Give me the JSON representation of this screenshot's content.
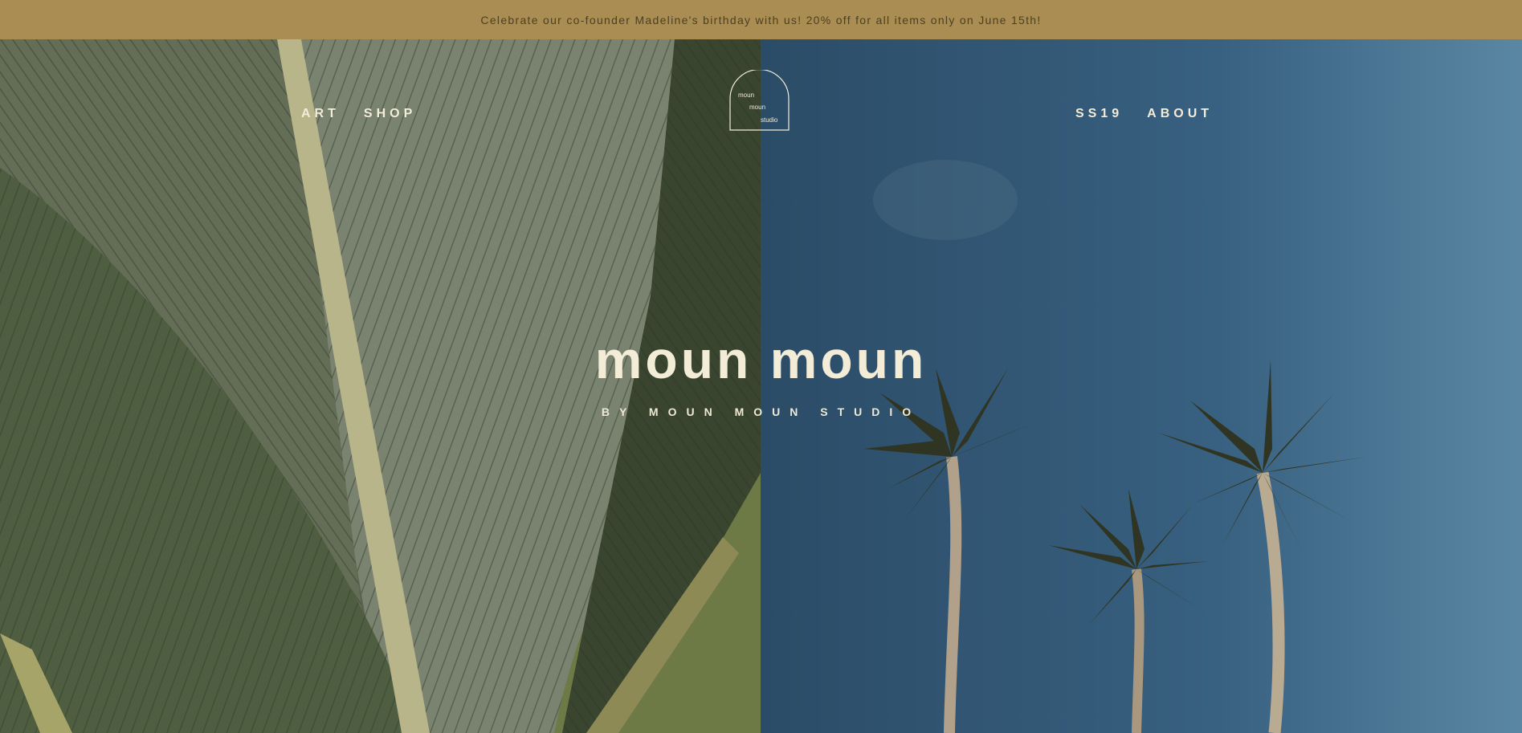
{
  "promo": {
    "text": "Celebrate our co-founder Madeline's birthday with us! 20% off for all items only on June 15th!"
  },
  "nav": {
    "left": [
      {
        "label": "ART"
      },
      {
        "label": "SHOP"
      }
    ],
    "right": [
      {
        "label": "SS19"
      },
      {
        "label": "ABOUT"
      }
    ]
  },
  "logo": {
    "lines": [
      "moun",
      "moun",
      "studio"
    ]
  },
  "hero": {
    "title": "moun moun",
    "subtitle": "BY MOUN MOUN STUDIO"
  },
  "colors": {
    "promo_bg": "#a98d52",
    "promo_text": "#4e3f24",
    "hero_text": "#f3ecd6",
    "leaf_green": "#4b5544",
    "sky_blue": "#2f5573"
  },
  "icons": [
    "banana-leaf-image",
    "palm-trees-image",
    "arch-logo-icon"
  ]
}
